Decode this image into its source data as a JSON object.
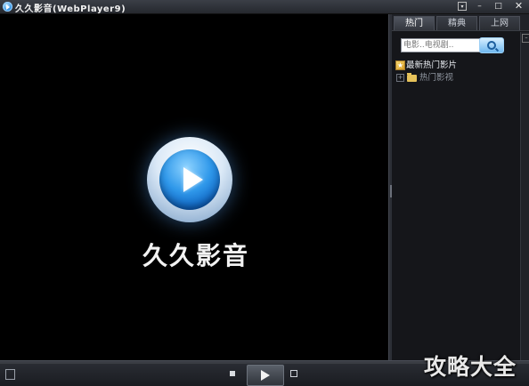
{
  "window": {
    "title": "久久影音(WebPlayer9)",
    "controls": {
      "menu": "▾",
      "minimize": "–",
      "maximize": "□",
      "close": "✕"
    }
  },
  "player": {
    "brand_name": "久久影音",
    "logo_icon": "play-logo-icon"
  },
  "panel": {
    "tabs": [
      {
        "label": "热门",
        "active": true
      },
      {
        "label": "精典",
        "active": false
      },
      {
        "label": "上网",
        "active": false
      }
    ],
    "search": {
      "placeholder": "电影..电视剧..",
      "button_icon": "search-icon"
    },
    "tree": [
      {
        "label": "最新热门影片",
        "icon": "star-icon"
      },
      {
        "label": "热门影视",
        "icon": "folder-icon",
        "expand": "+"
      }
    ]
  },
  "controls": {
    "buttons": [
      "playlist",
      "stop",
      "play",
      "next"
    ]
  },
  "watermark": {
    "text": "攻略大全"
  },
  "colors": {
    "accent": "#2f98ea",
    "background": "#000000",
    "panel": "#15161a"
  }
}
